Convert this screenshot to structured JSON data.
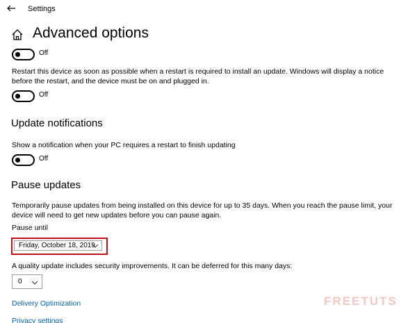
{
  "window": {
    "app_title": "Settings"
  },
  "page": {
    "title": "Advanced options"
  },
  "toggles": {
    "first": {
      "state_label": "Off"
    },
    "restart": {
      "state_label": "Off"
    },
    "notifications": {
      "state_label": "Off"
    }
  },
  "restart_description": "Restart this device as soon as possible when a restart is required to install an update. Windows will display a notice before the restart, and the device must be on and plugged in.",
  "update_notifications": {
    "heading": "Update notifications",
    "description": "Show a notification when your PC requires a restart to finish updating"
  },
  "pause_updates": {
    "heading": "Pause updates",
    "description": "Temporarily pause updates from being installed on this device for up to 35 days. When you reach the pause limit, your device will need to get new updates before you can pause again.",
    "pause_until_label": "Pause until",
    "pause_until_value": "Friday, October 18, 2019"
  },
  "quality_update": {
    "description": "A quality update includes security improvements. It can be deferred for this many days:",
    "days_value": "0"
  },
  "links": {
    "delivery_optimization": "Delivery Optimization",
    "privacy_settings": "Privacy settings"
  },
  "watermark": {
    "text": "FREETUTS"
  },
  "colors": {
    "highlight_border": "#c1121c",
    "link": "#0063b1",
    "watermark": "#f3c7c4"
  }
}
